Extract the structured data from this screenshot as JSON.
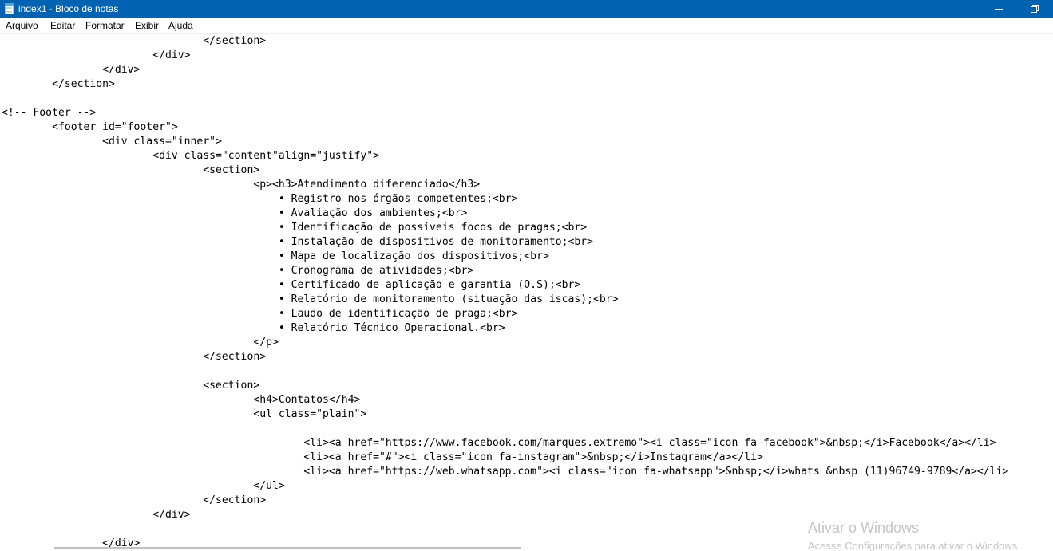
{
  "window": {
    "title": "index1 - Bloco de notas",
    "app_icon": "notepad-icon",
    "controls": [
      "minimize-icon",
      "restore-icon"
    ],
    "titlebar_color": "#0063b1"
  },
  "menu": {
    "items": [
      {
        "label": "Arquivo"
      },
      {
        "label": "Editar"
      },
      {
        "label": "Formatar"
      },
      {
        "label": "Exibir"
      },
      {
        "label": "Ajuda"
      }
    ]
  },
  "editor": {
    "lines": [
      "                                </section>",
      "                        </div>",
      "                </div>",
      "        </section>",
      "",
      "<!-- Footer -->",
      "        <footer id=\"footer\">",
      "                <div class=\"inner\">",
      "                        <div class=\"content\"align=\"justify\">",
      "                                <section>",
      "                                        <p><h3>Atendimento diferenciado</h3>",
      "                                            • Registro nos órgãos competentes;<br>",
      "                                            • Avaliação dos ambientes;<br>",
      "                                            • Identificação de possíveis focos de pragas;<br>",
      "                                            • Instalação de dispositivos de monitoramento;<br>",
      "                                            • Mapa de localização dos dispositivos;<br>",
      "                                            • Cronograma de atividades;<br>",
      "                                            • Certificado de aplicação e garantia (O.S);<br>",
      "                                            • Relatório de monitoramento (situação das iscas);<br>",
      "                                            • Laudo de identificação de praga;<br>",
      "                                            • Relatório Técnico Operacional.<br>",
      "                                        </p>",
      "                                </section>",
      "",
      "                                <section>",
      "                                        <h4>Contatos</h4>",
      "                                        <ul class=\"plain\">",
      "",
      "                                                <li><a href=\"https://www.facebook.com/marques.extremo\"><i class=\"icon fa-facebook\">&nbsp;</i>Facebook</a></li>",
      "                                                <li><a href=\"#\"><i class=\"icon fa-instagram\">&nbsp;</i>Instagram</a></li>",
      "                                                <li><a href=\"https://web.whatsapp.com\"><i class=\"icon fa-whatsapp\">&nbsp;</i>whats &nbsp (11)96749-9789</a></li>",
      "                                        </ul>",
      "                                </section>",
      "                        </div>",
      "",
      "                </div>"
    ]
  },
  "watermark": {
    "title": "Ativar o Windows",
    "subtitle": "Acesse Configurações para ativar o Windows."
  }
}
